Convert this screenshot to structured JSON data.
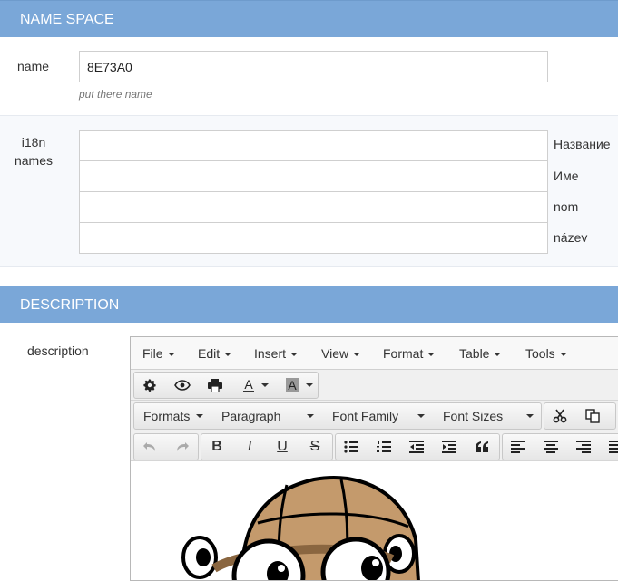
{
  "name_section": {
    "title": "NAME SPACE",
    "name_label": "name",
    "name_value": "8E73A0",
    "name_hint": "put there name",
    "i18n_label_line1": "i18n",
    "i18n_label_line2": "names",
    "i18n": [
      {
        "lang_label": "Название",
        "value": ""
      },
      {
        "lang_label": "Име",
        "value": ""
      },
      {
        "lang_label": "nom",
        "value": ""
      },
      {
        "lang_label": "název",
        "value": ""
      }
    ]
  },
  "description_section": {
    "title": "DESCRIPTION",
    "description_label": "description"
  },
  "editor": {
    "menubar": [
      "File",
      "Insert",
      "View",
      "Format",
      "Table",
      "Tools",
      "Edit"
    ],
    "menus": {
      "file": "File",
      "edit": "Edit",
      "insert": "Insert",
      "view": "View",
      "format": "Format",
      "table": "Table",
      "tools": "Tools"
    },
    "toolbar_dropdowns": {
      "formats": "Formats",
      "paragraph": "Paragraph",
      "font_family": "Font Family",
      "font_sizes": "Font Sizes"
    },
    "text_color_glyph": "A",
    "bg_color_glyph": "A",
    "icons": [
      "gear-icon",
      "eye-icon",
      "printer-icon",
      "text-color-icon",
      "background-color-icon",
      "scissors-icon",
      "copy-icon",
      "undo-icon",
      "redo-icon",
      "bold-icon",
      "italic-icon",
      "underline-icon",
      "strikethrough-icon",
      "bullet-list-icon",
      "numbered-list-icon",
      "outdent-icon",
      "indent-icon",
      "blockquote-icon",
      "align-left-icon",
      "align-center-icon",
      "align-right-icon"
    ],
    "glyphs": {
      "bold": "B",
      "italic": "I",
      "underline": "U",
      "strike": "S"
    },
    "colors": {
      "header": "#7aa7d8",
      "mascot_skin": "#c49a6c"
    }
  }
}
